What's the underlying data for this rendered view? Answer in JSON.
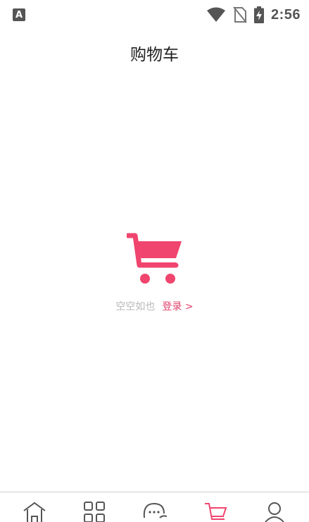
{
  "status_bar": {
    "app_icon_letter": "A",
    "time": "2:56",
    "icons": [
      "wifi-icon",
      "no-sim-icon",
      "battery-charging-icon"
    ]
  },
  "header": {
    "title": "购物车"
  },
  "empty_state": {
    "icon": "shopping-cart-icon",
    "message": "空空如也",
    "login_label": "登录 >"
  },
  "bottom_nav": {
    "items": [
      {
        "id": "home",
        "icon": "home-icon"
      },
      {
        "id": "category",
        "icon": "grid-icon"
      },
      {
        "id": "messages",
        "icon": "chat-icon"
      },
      {
        "id": "cart",
        "icon": "cart-icon",
        "active": true
      },
      {
        "id": "profile",
        "icon": "user-icon"
      }
    ]
  },
  "colors": {
    "accent": "#f0456e",
    "muted_text": "#b9b9b9",
    "title_text": "#222222",
    "nav_icon": "#555555"
  }
}
